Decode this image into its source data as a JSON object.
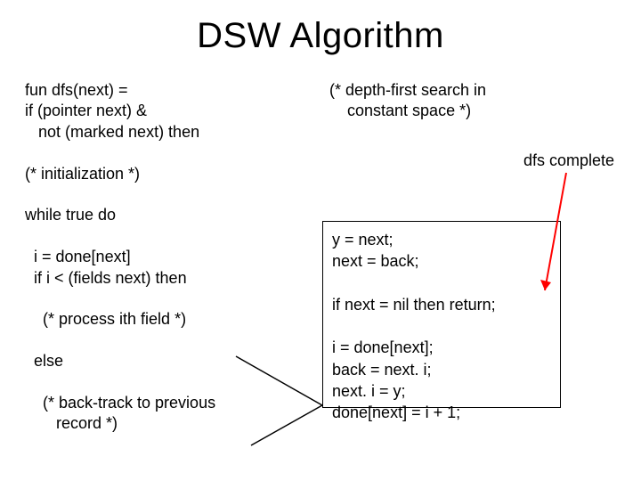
{
  "title": "DSW Algorithm",
  "left_code": "fun dfs(next) =\nif (pointer next) &\n   not (marked next) then\n\n(* initialization *)\n\nwhile true do\n\n  i = done[next]\n  if i < (fields next) then\n\n    (* process ith field *)\n\n  else\n\n    (* back-track to previous\n       record *)",
  "right_comment": "(* depth-first search in\n    constant space *)",
  "dfs_complete": "dfs complete",
  "box_code": "y = next;\nnext = back;\n\nif next = nil then return;\n\ni = done[next];\nback = next. i;\nnext. i = y;\ndone[next] = i + 1;"
}
